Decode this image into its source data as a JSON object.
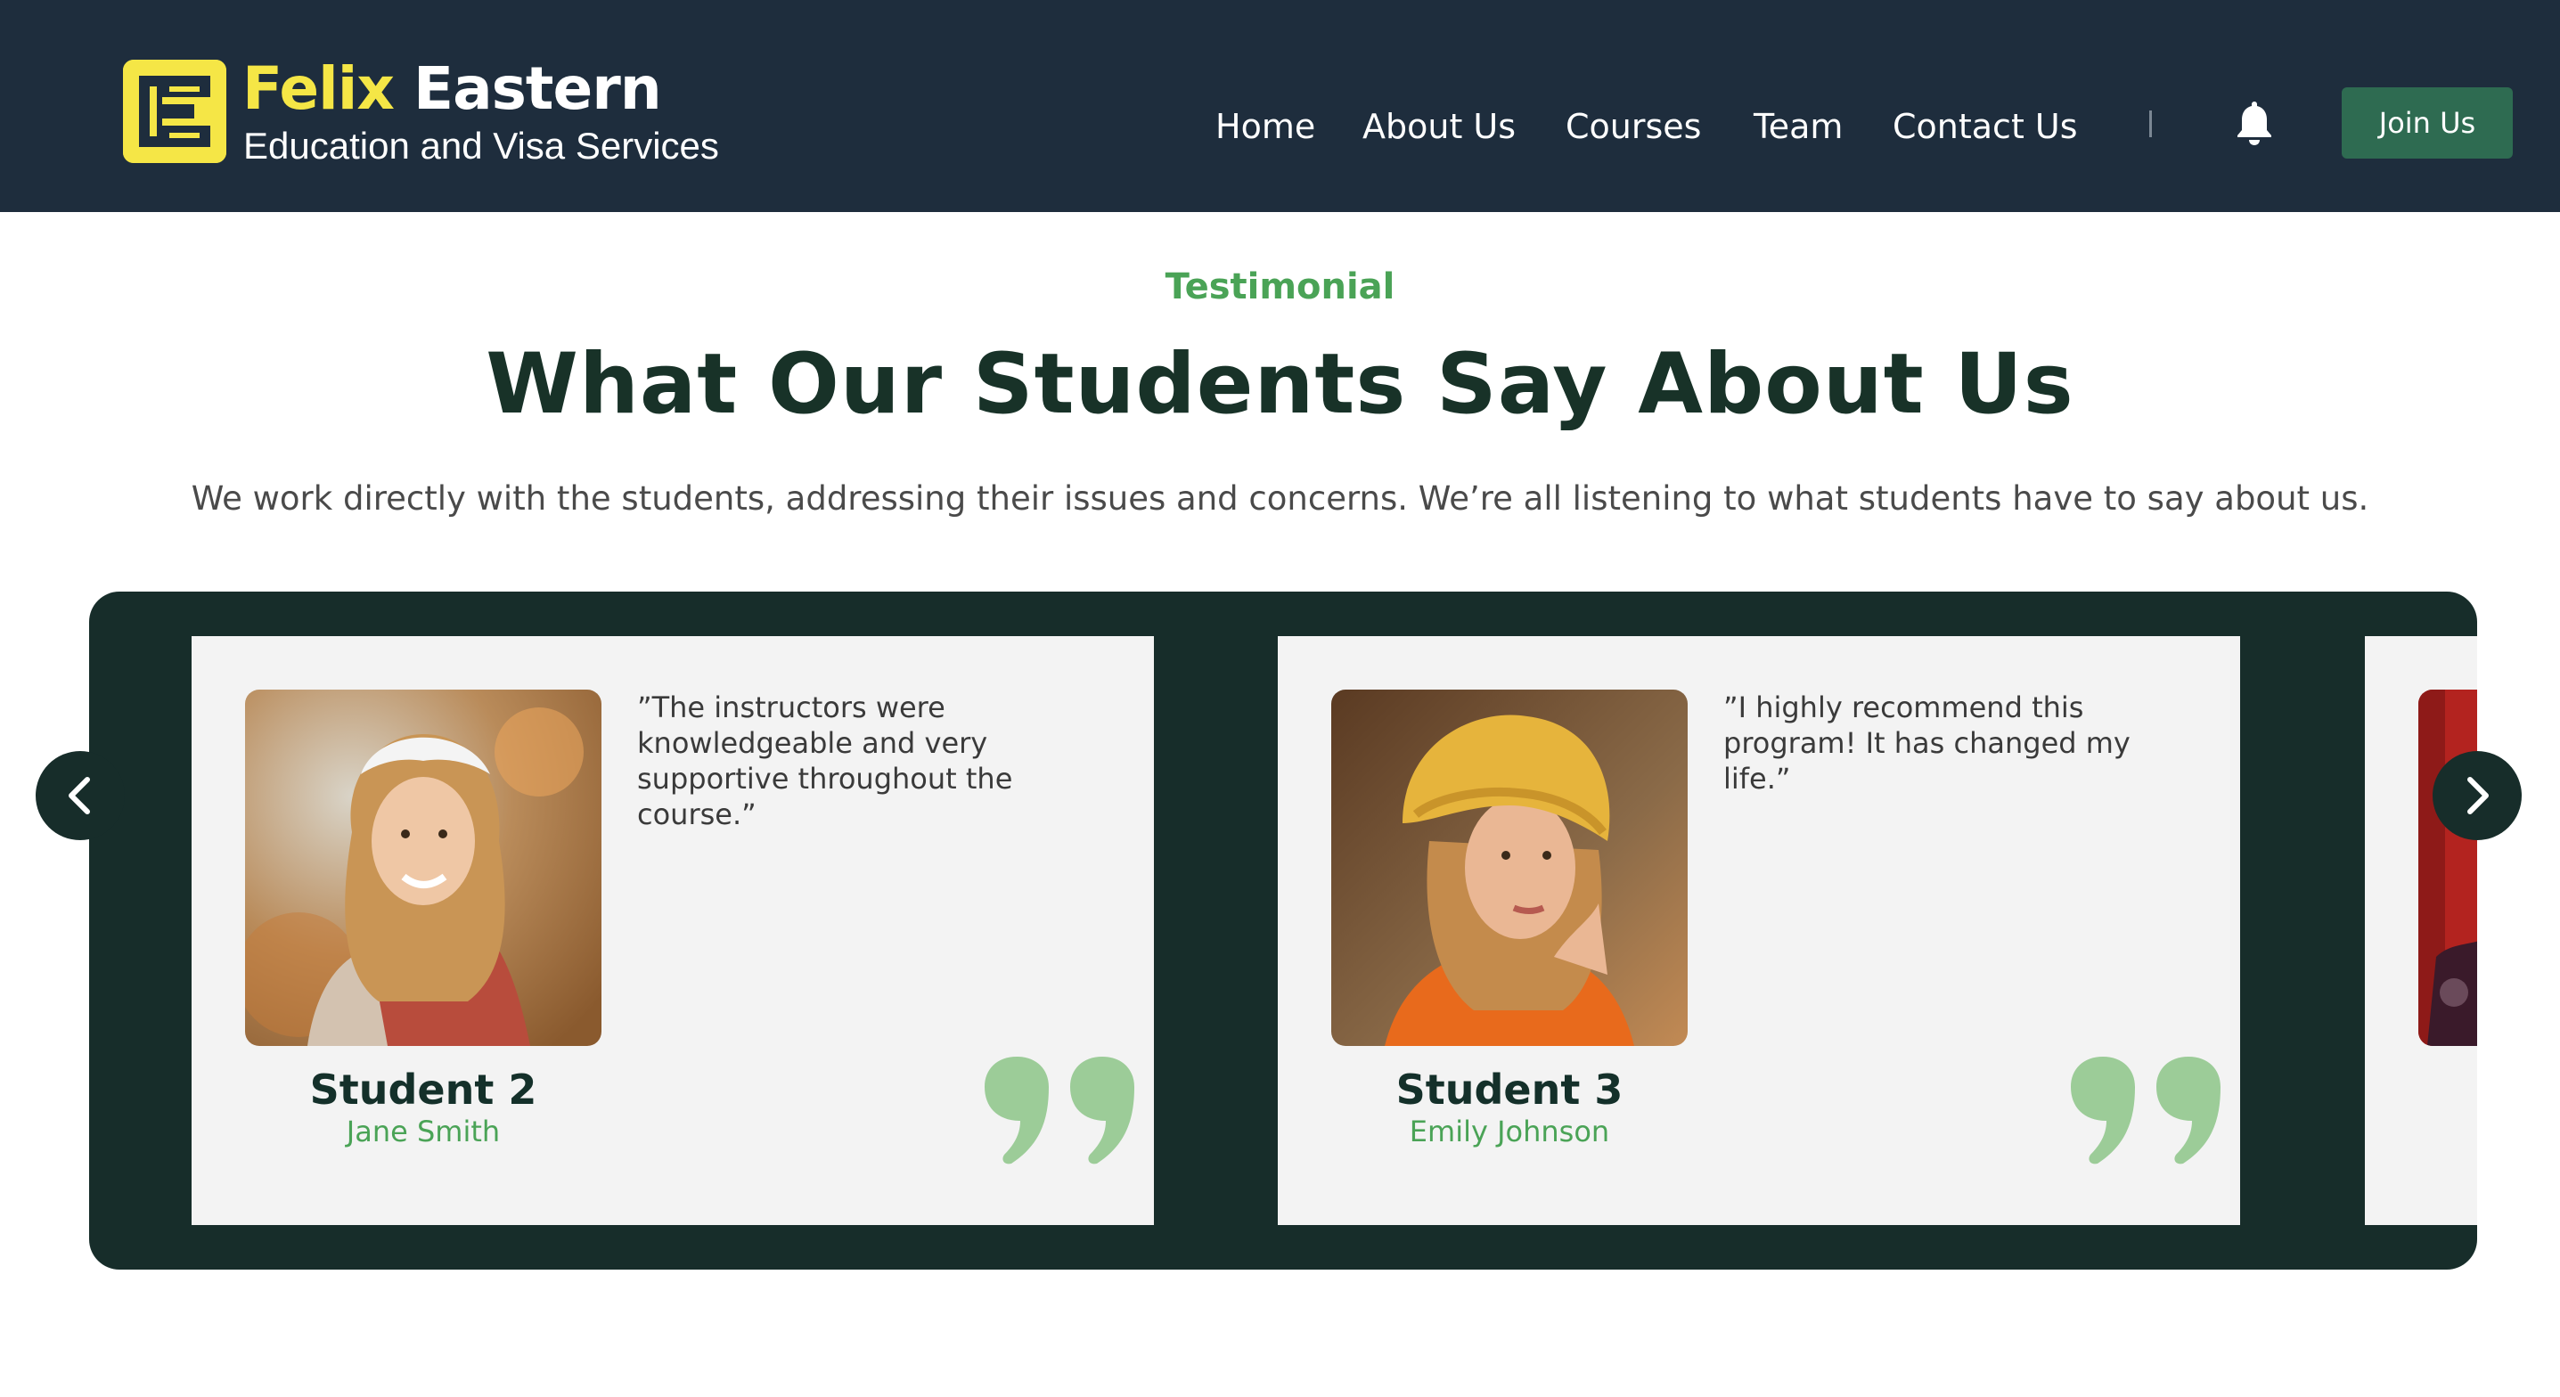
{
  "header": {
    "brand_word1": "Felix",
    "brand_word2": "Eastern",
    "tagline": "Education and Visa Services",
    "nav": [
      "Home",
      "About Us",
      "Courses",
      "Team",
      "Contact Us"
    ],
    "divider": "|",
    "bell_icon": "bell-icon",
    "join_label": "Join Us"
  },
  "section": {
    "eyebrow": "Testimonial",
    "title": "What Our Students Say About Us",
    "subtitle": "We work directly with the students, addressing their issues and concerns. We’re all listening to what students have to say about us."
  },
  "testimonials": [
    {
      "quote": "”The instructors were knowledgeable and very supportive throughout the course.”",
      "title": "Student 2",
      "name": "Jane Smith"
    },
    {
      "quote": "”I highly recommend this program! It has changed my life.”",
      "title": "Student 3",
      "name": "Emily Johnson"
    }
  ],
  "icons": {
    "prev": "chevron-left-icon",
    "next": "chevron-right-icon",
    "quote": "quote-mark-icon"
  },
  "colors": {
    "header_bg": "#1e2d3d",
    "brand_yellow": "#f5e646",
    "accent_green": "#4aa356",
    "button_green": "#2e6b51",
    "slider_bg": "#172d2a",
    "card_bg": "#f3f3f3",
    "quote_icon": "#9ccc98"
  }
}
